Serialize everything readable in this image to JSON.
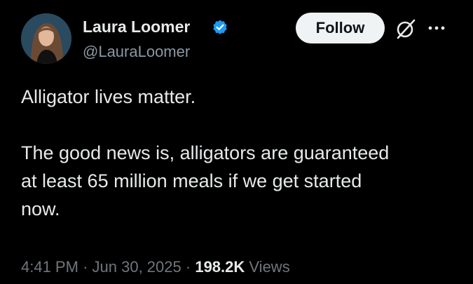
{
  "author": {
    "display_name": "Laura Loomer",
    "handle": "@LauraLoomer",
    "verified": true
  },
  "actions": {
    "follow_label": "Follow"
  },
  "tweet": {
    "line1": "Alligator lives matter.",
    "line2": "The good news is, alligators are guaranteed",
    "line3": "at least 65 million meals if we get started",
    "line4": "now."
  },
  "meta": {
    "time": "4:41 PM",
    "separator": "·",
    "date": "Jun 30, 2025",
    "views_count": "198.2K",
    "views_label": "Views"
  },
  "colors": {
    "background": "#000000",
    "primary_text": "#e7e9ea",
    "secondary_text": "#71767b",
    "verified_badge": "#1d9bf0",
    "follow_button_bg": "#eff3f4"
  },
  "icons": {
    "verified": "verified-badge-icon",
    "grok": "grok-icon",
    "more": "more-options-icon"
  }
}
